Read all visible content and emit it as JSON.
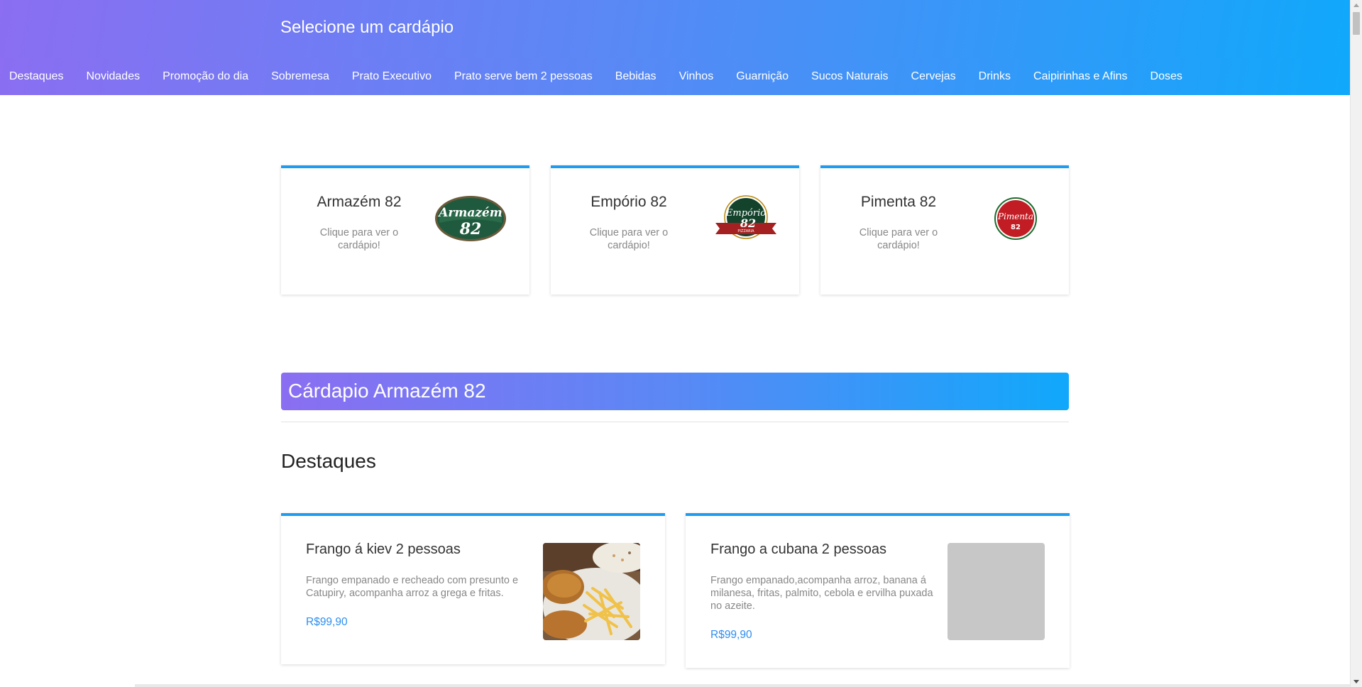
{
  "header": {
    "title": "Selecione um cardápio"
  },
  "nav": {
    "items": [
      "Destaques",
      "Novidades",
      "Promoção do dia",
      "Sobremesa",
      "Prato Executivo",
      "Prato serve bem 2 pessoas",
      "Bebidas",
      "Vinhos",
      "Guarnição",
      "Sucos Naturais",
      "Cervejas",
      "Drinks",
      "Caipirinhas e Afins",
      "Doses"
    ]
  },
  "restaurants": [
    {
      "name": "Armazém 82",
      "subtitle": "Clique para ver o cardápio!",
      "logo_text": "Armazém",
      "logo_number": "82"
    },
    {
      "name": "Empório 82",
      "subtitle": "Clique para ver o cardápio!",
      "logo_text": "Empório",
      "logo_number": "82",
      "logo_banner": "PIZZARIA"
    },
    {
      "name": "Pimenta 82",
      "subtitle": "Clique para ver o cardápio!",
      "logo_text": "Pimenta",
      "logo_number": "82"
    }
  ],
  "menu_banner": {
    "title": "Cárdapio Armazém 82"
  },
  "section": {
    "title": "Destaques"
  },
  "dishes": [
    {
      "name": "Frango á kiev 2 pessoas",
      "description": "Frango empanado e recheado com presunto e Catupiry, acompanha arroz a grega e fritas.",
      "price": "R$99,90",
      "image": "fried-chicken-fries-photo"
    },
    {
      "name": "Frango a cubana 2 pessoas",
      "description": "Frango empanado,acompanha arroz, banana á milanesa, fritas, palmito, cebola e ervilha puxada no azeite.",
      "price": "R$99,90",
      "image": "image-placeholder"
    }
  ],
  "colors": {
    "gradient_start": "#8b6ef2",
    "gradient_end": "#10a8fb",
    "card_accent": "#1f9bf0",
    "price": "#2d8ef0"
  }
}
